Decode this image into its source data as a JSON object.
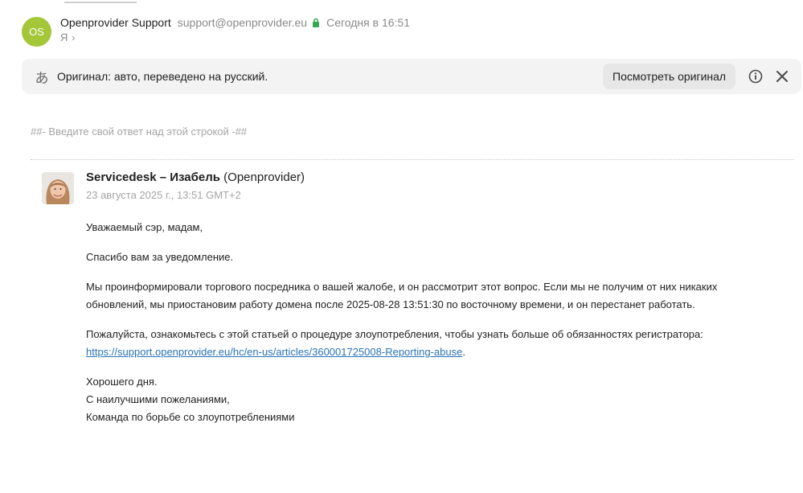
{
  "header": {
    "avatar_initials": "OS",
    "sender_name": "Openprovider Support",
    "sender_email": "support@openprovider.eu",
    "sent_time": "Сегодня в 16:51",
    "recipient": "Я"
  },
  "banner": {
    "text": "Оригинал: авто, переведено на русский.",
    "view_original_label": "Посмотреть оригинал"
  },
  "body": {
    "reply_marker": "##- Введите свой ответ над этой строкой -##",
    "quote": {
      "author_bold": "Servicedesk – Изабель",
      "author_org": "(Openprovider)",
      "date": "23 августа 2025 г., 13:51 GMT+2"
    },
    "greeting": "Уважаемый сэр, мадам,",
    "thanks": "Спасибо вам за уведомление.",
    "paragraph1": "Мы проинформировали торгового посредника о вашей жалобе, и он рассмотрит этот вопрос. Если мы не получим от них никаких обновлений, мы приостановим работу домена после 2025-08-28 13:51:30 по восточному времени, и он перестанет работать.",
    "paragraph2": "Пожалуйста, ознакомьтесь с этой статьей о процедуре злоупотребления, чтобы узнать больше об обязанностях регистратора:",
    "link": "https://support.openprovider.eu/hc/en-us/articles/360001725008-Reporting-abuse",
    "link_suffix": ".",
    "closing": "Хорошего дня.",
    "regards": "С наилучшими пожеланиями,",
    "team": "Команда по борьбе со злоупотреблениями"
  },
  "colors": {
    "avatar_bg": "#a4c639",
    "lock": "#34a853",
    "link": "#2a73b8",
    "banner_bg": "#f3f3f3"
  },
  "icons": [
    "lock-icon",
    "chevron-right-icon",
    "translate-icon",
    "info-icon",
    "close-icon"
  ]
}
